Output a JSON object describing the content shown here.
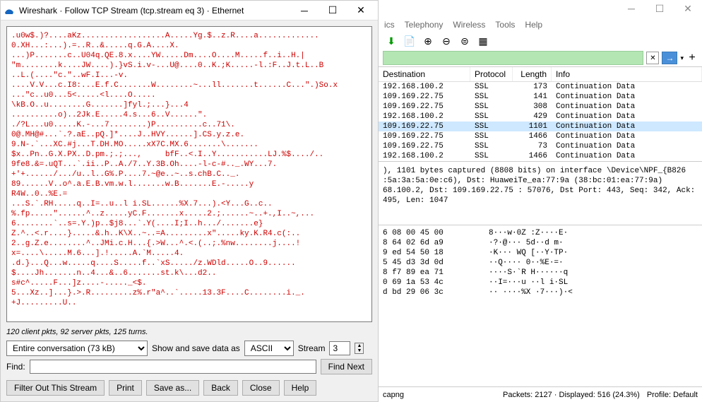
{
  "dialog": {
    "title": "Wireshark · Follow TCP Stream (tcp.stream eq 3) · Ethernet",
    "stream_text_client": ".u0w$.)?....aKz..................A.....Yg.$..z.R....a.............\n0.XH...:...).=..R..&.....q.G.A....X.\n...)P.......c..U04q.QE.8.x....YW.....Dm....O....M.....f..i..H.|\n\"m........k....JW....).}vS.i.v-...U@....0..K.;K.....-l.:F..J.t.L..B\n..L.(....\"c.\"..wF.I...-v.\n....V.V...c.I8:...E.f.C.......W........~...ll.......t......C...\".)So.x\n...\"c..u0...5<.....<l....O.....\n\\kB.O..u........G.......]fyl.;...}...4\n..........o)..2Jk.E.....4.s...6..V......\".\n./?L...u0.....K.-...7........)P..........c..71\\.\n0@.MH@#...`.?.aE..pQ.]*....J..HVY......].CS.y.z.e.\n9.N-.`...XC.#j...T.DH.MO.....xX7C.MX.6.......\\.......\n$x..Pn..G.X.PX..D.pm.;.;...,     bfF..<.I..Y...........LJ.%$..../..\n9fe8.&=.uQT...`.ii..P..A./7..Y.3B.Oh....-l-c-#.._.WY...7.\n+'+....../.../u..l..G%.P....7.~@e..~..s.chB.C.._.\n89......V..o^.a.E.B.vm.w.l.......w.B.......E.-.....y\nR4W..0..%E.=\n...S.`.RH.....q..I=..u..l i.SL......%X.7...).<Y...G..c..\n%.fp.....\"......^..z.....yC.F.......x.....2.;......~..+.,I..~,...\n6........`..s=.Y.)p..$j8...`.Y(....I;I..h.../.......e}\nZ.^..<.r....}.....&.h..K\\X..~..=A.........x\".....ky.K.R4.c(:..\n2..g.Z.e........^..JMi.c.H...{.>W...^.<.(..;.%nw........j....!\nx=....\\.....M.6...].!.....A.`M.....4.\n.d.}...Q...w.....q....S.....f..`xS...../z.WDld.....O..9......\n$....Jh.......n..4...&..6.......st.k\\...d2..\ns#c^.....F...]z....-....._<$.\n5...Xz..]...}.>.R.........z%.r\"a^..`.....13.3F....C........i._.\n+J.........U..",
    "pktinfo": "120 client pkts, 92 server pkts, 125 turns.",
    "entire_combo": "Entire conversation (73 kB)",
    "showas_label": "Show and save data as",
    "ascii_combo": "ASCII",
    "stream_label": "Stream",
    "stream_num": "3",
    "find_label": "Find:",
    "find_btn": "Find Next",
    "buttons": {
      "filter": "Filter Out This Stream",
      "print": "Print",
      "saveas": "Save as...",
      "back": "Back",
      "close": "Close",
      "help": "Help"
    }
  },
  "main": {
    "menu": [
      "ics",
      "Telephony",
      "Wireless",
      "Tools",
      "Help"
    ],
    "cols": {
      "dest": "Destination",
      "proto": "Protocol",
      "len": "Length",
      "info": "Info"
    },
    "rows": [
      {
        "dest": "192.168.100.2",
        "proto": "SSL",
        "len": "173",
        "info": "Continuation Data",
        "sel": false
      },
      {
        "dest": "109.169.22.75",
        "proto": "SSL",
        "len": "141",
        "info": "Continuation Data",
        "sel": false
      },
      {
        "dest": "109.169.22.75",
        "proto": "SSL",
        "len": "308",
        "info": "Continuation Data",
        "sel": false
      },
      {
        "dest": "192.168.100.2",
        "proto": "SSL",
        "len": "429",
        "info": "Continuation Data",
        "sel": false
      },
      {
        "dest": "109.169.22.75",
        "proto": "SSL",
        "len": "1101",
        "info": "Continuation Data",
        "sel": true
      },
      {
        "dest": "109.169.22.75",
        "proto": "SSL",
        "len": "1466",
        "info": "Continuation Data",
        "sel": false
      },
      {
        "dest": "109.169.22.75",
        "proto": "SSL",
        "len": "73",
        "info": "Continuation Data",
        "sel": false
      },
      {
        "dest": "192.168.100.2",
        "proto": "SSL",
        "len": "1466",
        "info": "Continuation Data",
        "sel": false
      }
    ],
    "details": "), 1101 bytes captured (8808 bits) on interface \\Device\\NPF_{B826\n:5a:3a:5a:0e:c6), Dst: HuaweiTe_ea:77:9a (38:bc:01:ea:77:9a)\n68.100.2, Dst: 109.169.22.75\n: 57076, Dst Port: 443, Seq: 342, Ack: 495, Len: 1047",
    "hex_lines": [
      {
        "h": "6 08 00 45 00",
        "a": "8···w·0Z :Z····E·"
      },
      {
        "h": "8 64 02 6d a9",
        "a": "·?·@··· 5d··d m·"
      },
      {
        "h": "9 ed 54 50 18",
        "a": "·K··· WQ [··Y·TP·"
      },
      {
        "h": "5 45 d3 3d 0d",
        "a": "··Q···· 0··%E·=·"
      },
      {
        "h": "8 f7 89 ea 71",
        "a": "····S·`R H······q"
      },
      {
        "h": "0 69 1a 53 4c",
        "a": "··I=···u ··l i·SL"
      },
      {
        "h": "d bd 29 06 3c",
        "a": "·· ····%X ·7···)·<"
      }
    ],
    "status": {
      "left": "capng",
      "pkts": "Packets: 2127 · Displayed: 516 (24.3%)",
      "profile": "Profile: Default"
    }
  }
}
